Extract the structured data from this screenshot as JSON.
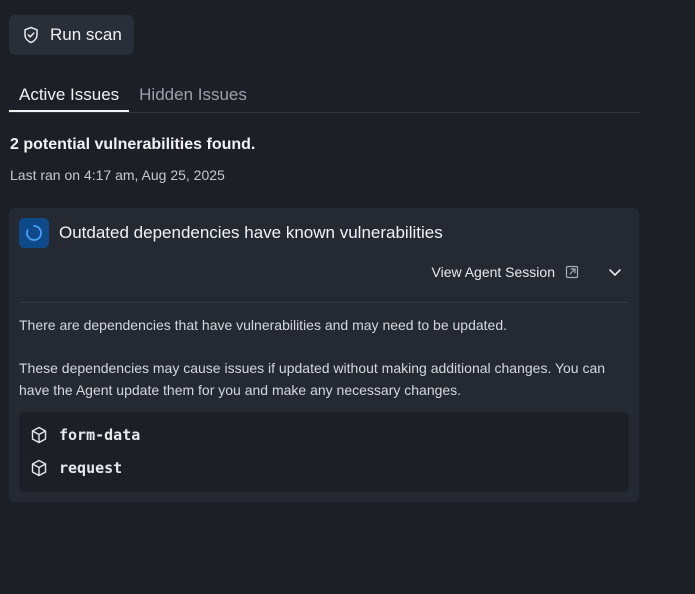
{
  "toolbar": {
    "run_scan_label": "Run scan",
    "run_scan_icon": "shield-check-icon"
  },
  "tabs": [
    {
      "label": "Active Issues",
      "active": true
    },
    {
      "label": "Hidden Issues",
      "active": false
    }
  ],
  "summary": {
    "title": "2 potential vulnerabilities found.",
    "last_ran": "Last ran on 4:17 am, Aug 25, 2025"
  },
  "issue": {
    "status_icon": "loading-spinner-icon",
    "title": "Outdated dependencies have known vulnerabilities",
    "agent_link_label": "View Agent Session",
    "description_1": "There are dependencies that have vulnerabilities and may need to be updated.",
    "description_2": "These dependencies may cause issues if updated without making additional changes. You can have the Agent update them for you and make any necessary changes.",
    "dependencies": [
      {
        "name": "form-data",
        "icon": "package-icon"
      },
      {
        "name": "request",
        "icon": "package-icon"
      }
    ]
  },
  "colors": {
    "background": "#1c1f26",
    "card": "#252932",
    "button": "#2a2e38",
    "accent_badge": "#0e4a8a",
    "spinner": "#4a9ef5"
  }
}
